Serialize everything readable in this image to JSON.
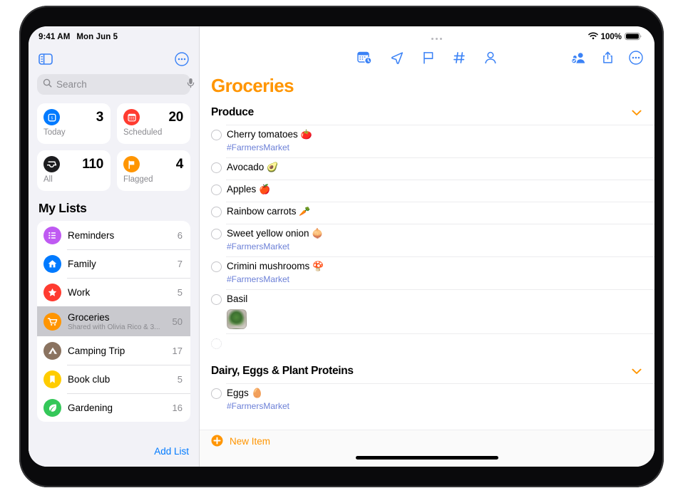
{
  "status_bar": {
    "time": "9:41 AM",
    "date": "Mon Jun 5",
    "battery_percent": "100%",
    "wifi_icon": "wifi-icon",
    "battery_icon": "battery-full-icon"
  },
  "sidebar": {
    "toggle_icon": "sidebar-toggle-icon",
    "more_icon": "more-ellipsis-circle-icon",
    "search": {
      "placeholder": "Search",
      "value": "",
      "search_icon": "search-icon",
      "mic_icon": "microphone-icon"
    },
    "smart_lists": [
      {
        "label": "Today",
        "count": "3",
        "icon": "calendar-day-icon",
        "color": "#007aff"
      },
      {
        "label": "Scheduled",
        "count": "20",
        "icon": "calendar-scheduled-icon",
        "color": "#ff3b30"
      },
      {
        "label": "All",
        "count": "110",
        "icon": "inbox-tray-icon",
        "color": "#1c1c1e"
      },
      {
        "label": "Flagged",
        "count": "4",
        "icon": "flag-icon",
        "color": "#ff9500"
      }
    ],
    "my_lists_title": "My Lists",
    "lists": [
      {
        "name": "Reminders",
        "subtitle": "",
        "count": "6",
        "icon": "bullet-list-icon",
        "color": "#bf5af2",
        "selected": false
      },
      {
        "name": "Family",
        "subtitle": "",
        "count": "7",
        "icon": "house-icon",
        "color": "#007aff",
        "selected": false
      },
      {
        "name": "Work",
        "subtitle": "",
        "count": "5",
        "icon": "star-icon",
        "color": "#ff3b30",
        "selected": false
      },
      {
        "name": "Groceries",
        "subtitle": "Shared with Olivia Rico & 3...",
        "count": "50",
        "icon": "shopping-cart-icon",
        "color": "#ff9500",
        "selected": true
      },
      {
        "name": "Camping Trip",
        "subtitle": "",
        "count": "17",
        "icon": "tent-icon",
        "color": "#8a7360",
        "selected": false
      },
      {
        "name": "Book club",
        "subtitle": "",
        "count": "5",
        "icon": "bookmark-icon",
        "color": "#ffcc00",
        "selected": false
      },
      {
        "name": "Gardening",
        "subtitle": "",
        "count": "16",
        "icon": "leaf-icon",
        "color": "#34c759",
        "selected": false
      }
    ],
    "add_list_label": "Add List"
  },
  "main": {
    "toolbar_center": [
      {
        "icon": "calendar-clock-icon"
      },
      {
        "icon": "location-arrow-icon"
      },
      {
        "icon": "flag-outline-icon"
      },
      {
        "icon": "hashtag-icon"
      },
      {
        "icon": "person-outline-icon"
      }
    ],
    "toolbar_right": [
      {
        "icon": "shared-person-badge-icon"
      },
      {
        "icon": "share-upload-icon"
      },
      {
        "icon": "more-ellipsis-circle-icon"
      }
    ],
    "title": "Groceries",
    "title_color": "#ff9500",
    "groups": [
      {
        "header": "Produce",
        "chevron_icon": "chevron-down-icon",
        "items": [
          {
            "title": "Cherry tomatoes",
            "emoji": "🍅",
            "tag": "#FarmersMarket",
            "photo": false,
            "empty": false
          },
          {
            "title": "Avocado",
            "emoji": "🥑",
            "tag": "",
            "photo": false,
            "empty": false
          },
          {
            "title": "Apples",
            "emoji": "🍎",
            "tag": "",
            "photo": false,
            "empty": false
          },
          {
            "title": "Rainbow carrots",
            "emoji": "🥕",
            "tag": "",
            "photo": false,
            "empty": false
          },
          {
            "title": "Sweet yellow onion",
            "emoji": "🧅",
            "tag": "#FarmersMarket",
            "photo": false,
            "empty": false
          },
          {
            "title": "Crimini mushrooms",
            "emoji": "🍄",
            "tag": "#FarmersMarket",
            "photo": false,
            "empty": false
          },
          {
            "title": "Basil",
            "emoji": "",
            "tag": "",
            "photo": true,
            "empty": false
          },
          {
            "title": "",
            "emoji": "",
            "tag": "",
            "photo": false,
            "empty": true
          }
        ]
      },
      {
        "header": "Dairy, Eggs & Plant Proteins",
        "chevron_icon": "chevron-down-icon",
        "items": [
          {
            "title": "Eggs",
            "emoji": "🥚",
            "tag": "#FarmersMarket",
            "photo": false,
            "empty": false
          }
        ]
      }
    ],
    "new_item": {
      "label": "New Item",
      "icon": "plus-circle-icon"
    }
  }
}
